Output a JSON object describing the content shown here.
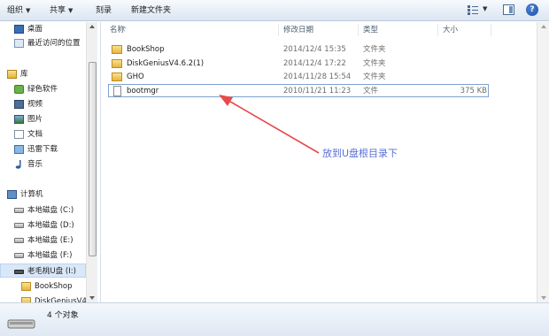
{
  "toolbar": {
    "organize": "组织",
    "share": "共享",
    "burn": "刻录",
    "new_folder": "新建文件夹",
    "help": "?"
  },
  "nav": {
    "items": [
      {
        "label": "桌面",
        "icon": "desktop-icon"
      },
      {
        "label": "最近访问的位置",
        "icon": "recent-places-icon"
      },
      {
        "label": "库",
        "icon": "library-icon"
      },
      {
        "label": "绿色软件",
        "icon": "green-software-icon"
      },
      {
        "label": "视频",
        "icon": "video-icon"
      },
      {
        "label": "图片",
        "icon": "pictures-icon"
      },
      {
        "label": "文档",
        "icon": "documents-icon"
      },
      {
        "label": "迅雷下载",
        "icon": "thunder-download-icon"
      },
      {
        "label": "音乐",
        "icon": "music-icon"
      },
      {
        "label": "计算机",
        "icon": "computer-icon"
      },
      {
        "label": "本地磁盘 (C:)",
        "icon": "local-disk-icon"
      },
      {
        "label": "本地磁盘 (D:)",
        "icon": "local-disk-icon"
      },
      {
        "label": "本地磁盘 (E:)",
        "icon": "local-disk-icon"
      },
      {
        "label": "本地磁盘 (F:)",
        "icon": "local-disk-icon"
      },
      {
        "label": "老毛桃U盘 (I:)",
        "icon": "usb-drive-icon"
      },
      {
        "label": "BookShop",
        "icon": "folder-icon"
      },
      {
        "label": "DiskGeniusV4",
        "icon": "folder-icon"
      }
    ]
  },
  "columns": {
    "name": "名称",
    "date": "修改日期",
    "type": "类型",
    "size": "大小"
  },
  "files": [
    {
      "name": "BookShop",
      "date": "2014/12/4 15:35",
      "type": "文件夹",
      "size": "",
      "icon": "folder-icon"
    },
    {
      "name": "DiskGeniusV4.6.2(1)",
      "date": "2014/12/4 17:22",
      "type": "文件夹",
      "size": "",
      "icon": "folder-icon"
    },
    {
      "name": "GHO",
      "date": "2014/11/28 15:54",
      "type": "文件夹",
      "size": "",
      "icon": "folder-icon"
    },
    {
      "name": "bootmgr",
      "date": "2010/11/21 11:23",
      "type": "文件",
      "size": "375 KB",
      "icon": "file-icon"
    }
  ],
  "annotation": {
    "text": "放到U盘根目录下",
    "color": "#e84a4a"
  },
  "status": {
    "count": "4 个对象"
  },
  "colors": {
    "toolbar_bg": "#e6edf6",
    "selection": "#d9e7f8",
    "annotation_text": "#5a6fd6"
  }
}
